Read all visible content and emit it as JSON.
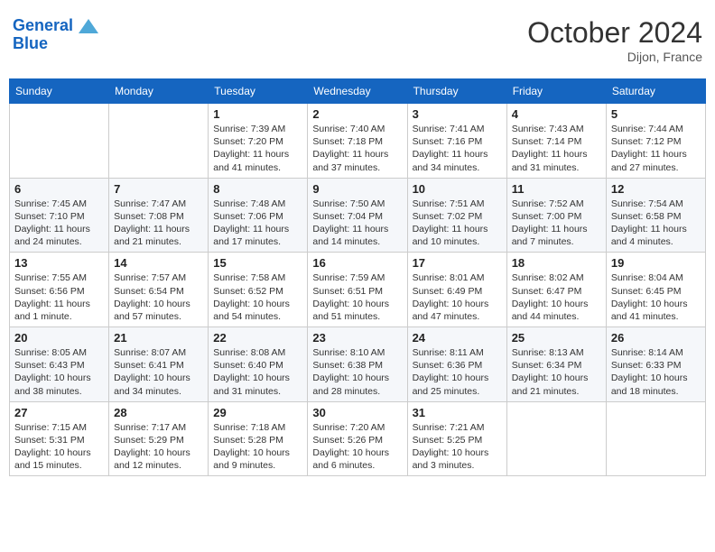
{
  "header": {
    "logo_line1": "General",
    "logo_line2": "Blue",
    "month": "October 2024",
    "location": "Dijon, France"
  },
  "weekdays": [
    "Sunday",
    "Monday",
    "Tuesday",
    "Wednesday",
    "Thursday",
    "Friday",
    "Saturday"
  ],
  "weeks": [
    [
      {
        "day": "",
        "info": ""
      },
      {
        "day": "",
        "info": ""
      },
      {
        "day": "1",
        "info": "Sunrise: 7:39 AM\nSunset: 7:20 PM\nDaylight: 11 hours and 41 minutes."
      },
      {
        "day": "2",
        "info": "Sunrise: 7:40 AM\nSunset: 7:18 PM\nDaylight: 11 hours and 37 minutes."
      },
      {
        "day": "3",
        "info": "Sunrise: 7:41 AM\nSunset: 7:16 PM\nDaylight: 11 hours and 34 minutes."
      },
      {
        "day": "4",
        "info": "Sunrise: 7:43 AM\nSunset: 7:14 PM\nDaylight: 11 hours and 31 minutes."
      },
      {
        "day": "5",
        "info": "Sunrise: 7:44 AM\nSunset: 7:12 PM\nDaylight: 11 hours and 27 minutes."
      }
    ],
    [
      {
        "day": "6",
        "info": "Sunrise: 7:45 AM\nSunset: 7:10 PM\nDaylight: 11 hours and 24 minutes."
      },
      {
        "day": "7",
        "info": "Sunrise: 7:47 AM\nSunset: 7:08 PM\nDaylight: 11 hours and 21 minutes."
      },
      {
        "day": "8",
        "info": "Sunrise: 7:48 AM\nSunset: 7:06 PM\nDaylight: 11 hours and 17 minutes."
      },
      {
        "day": "9",
        "info": "Sunrise: 7:50 AM\nSunset: 7:04 PM\nDaylight: 11 hours and 14 minutes."
      },
      {
        "day": "10",
        "info": "Sunrise: 7:51 AM\nSunset: 7:02 PM\nDaylight: 11 hours and 10 minutes."
      },
      {
        "day": "11",
        "info": "Sunrise: 7:52 AM\nSunset: 7:00 PM\nDaylight: 11 hours and 7 minutes."
      },
      {
        "day": "12",
        "info": "Sunrise: 7:54 AM\nSunset: 6:58 PM\nDaylight: 11 hours and 4 minutes."
      }
    ],
    [
      {
        "day": "13",
        "info": "Sunrise: 7:55 AM\nSunset: 6:56 PM\nDaylight: 11 hours and 1 minute."
      },
      {
        "day": "14",
        "info": "Sunrise: 7:57 AM\nSunset: 6:54 PM\nDaylight: 10 hours and 57 minutes."
      },
      {
        "day": "15",
        "info": "Sunrise: 7:58 AM\nSunset: 6:52 PM\nDaylight: 10 hours and 54 minutes."
      },
      {
        "day": "16",
        "info": "Sunrise: 7:59 AM\nSunset: 6:51 PM\nDaylight: 10 hours and 51 minutes."
      },
      {
        "day": "17",
        "info": "Sunrise: 8:01 AM\nSunset: 6:49 PM\nDaylight: 10 hours and 47 minutes."
      },
      {
        "day": "18",
        "info": "Sunrise: 8:02 AM\nSunset: 6:47 PM\nDaylight: 10 hours and 44 minutes."
      },
      {
        "day": "19",
        "info": "Sunrise: 8:04 AM\nSunset: 6:45 PM\nDaylight: 10 hours and 41 minutes."
      }
    ],
    [
      {
        "day": "20",
        "info": "Sunrise: 8:05 AM\nSunset: 6:43 PM\nDaylight: 10 hours and 38 minutes."
      },
      {
        "day": "21",
        "info": "Sunrise: 8:07 AM\nSunset: 6:41 PM\nDaylight: 10 hours and 34 minutes."
      },
      {
        "day": "22",
        "info": "Sunrise: 8:08 AM\nSunset: 6:40 PM\nDaylight: 10 hours and 31 minutes."
      },
      {
        "day": "23",
        "info": "Sunrise: 8:10 AM\nSunset: 6:38 PM\nDaylight: 10 hours and 28 minutes."
      },
      {
        "day": "24",
        "info": "Sunrise: 8:11 AM\nSunset: 6:36 PM\nDaylight: 10 hours and 25 minutes."
      },
      {
        "day": "25",
        "info": "Sunrise: 8:13 AM\nSunset: 6:34 PM\nDaylight: 10 hours and 21 minutes."
      },
      {
        "day": "26",
        "info": "Sunrise: 8:14 AM\nSunset: 6:33 PM\nDaylight: 10 hours and 18 minutes."
      }
    ],
    [
      {
        "day": "27",
        "info": "Sunrise: 7:15 AM\nSunset: 5:31 PM\nDaylight: 10 hours and 15 minutes."
      },
      {
        "day": "28",
        "info": "Sunrise: 7:17 AM\nSunset: 5:29 PM\nDaylight: 10 hours and 12 minutes."
      },
      {
        "day": "29",
        "info": "Sunrise: 7:18 AM\nSunset: 5:28 PM\nDaylight: 10 hours and 9 minutes."
      },
      {
        "day": "30",
        "info": "Sunrise: 7:20 AM\nSunset: 5:26 PM\nDaylight: 10 hours and 6 minutes."
      },
      {
        "day": "31",
        "info": "Sunrise: 7:21 AM\nSunset: 5:25 PM\nDaylight: 10 hours and 3 minutes."
      },
      {
        "day": "",
        "info": ""
      },
      {
        "day": "",
        "info": ""
      }
    ]
  ]
}
